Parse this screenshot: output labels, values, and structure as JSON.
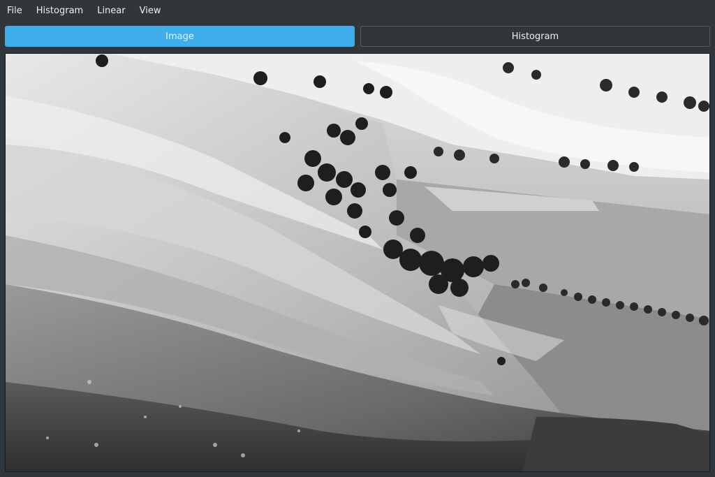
{
  "menubar": {
    "items": [
      {
        "label": "File"
      },
      {
        "label": "Histogram"
      },
      {
        "label": "Linear"
      },
      {
        "label": "View"
      }
    ]
  },
  "tabs": [
    {
      "label": "Image",
      "active": true
    },
    {
      "label": "Histogram",
      "active": false
    }
  ],
  "image": {
    "content": "grayscale-landscape-photo"
  },
  "colors": {
    "window_bg": "#31363b",
    "accent": "#3daee9",
    "text": "#eff0f1",
    "tab_border": "#5a5e62"
  }
}
